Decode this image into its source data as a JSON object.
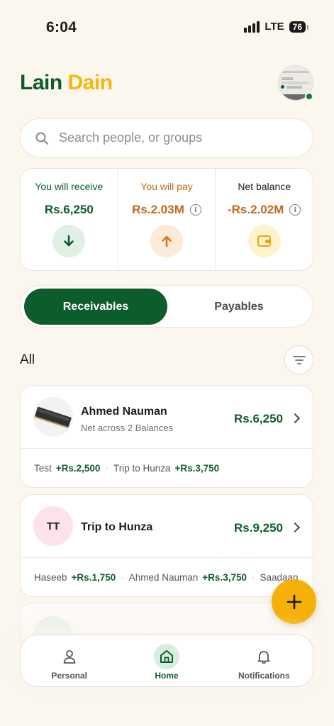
{
  "status_bar": {
    "time": "6:04",
    "network": "LTE",
    "battery": "76"
  },
  "header": {
    "brand_part1": "Lain",
    "brand_part2": "Dain"
  },
  "search": {
    "placeholder": "Search people, or groups"
  },
  "summary": {
    "receive": {
      "label": "You will receive",
      "value": "Rs.6,250",
      "color": "#0d5c2c"
    },
    "pay": {
      "label": "You will pay",
      "value": "Rs.2.03M",
      "color": "#c2691f"
    },
    "net": {
      "label": "Net balance",
      "value": "-Rs.2.02M",
      "color": "#c2691f"
    }
  },
  "tabs": {
    "active": "Receivables",
    "inactive": "Payables"
  },
  "section": {
    "title": "All"
  },
  "items": [
    {
      "name": "Ahmed Nauman",
      "subtitle": "Net across 2 Balances",
      "amount": "Rs.6,250",
      "breakdown": [
        {
          "label": "Test",
          "amount": "+Rs.2,500"
        },
        {
          "label": "Trip to Hunza",
          "amount": "+Rs.3,750"
        }
      ]
    },
    {
      "initials": "TT",
      "name": "Trip to Hunza",
      "amount": "Rs.9,250",
      "breakdown": [
        {
          "label": "Haseeb",
          "amount": "+Rs.1,750"
        },
        {
          "label": "Ahmed Nauman",
          "amount": "+Rs.3,750"
        },
        {
          "label": "Saadaan",
          "amount": ""
        }
      ]
    }
  ],
  "nav": {
    "personal": "Personal",
    "home": "Home",
    "notifications": "Notifications"
  },
  "colors": {
    "primary": "#0d5c2c",
    "accent": "#f5b10a",
    "background": "#fbf6ee"
  }
}
